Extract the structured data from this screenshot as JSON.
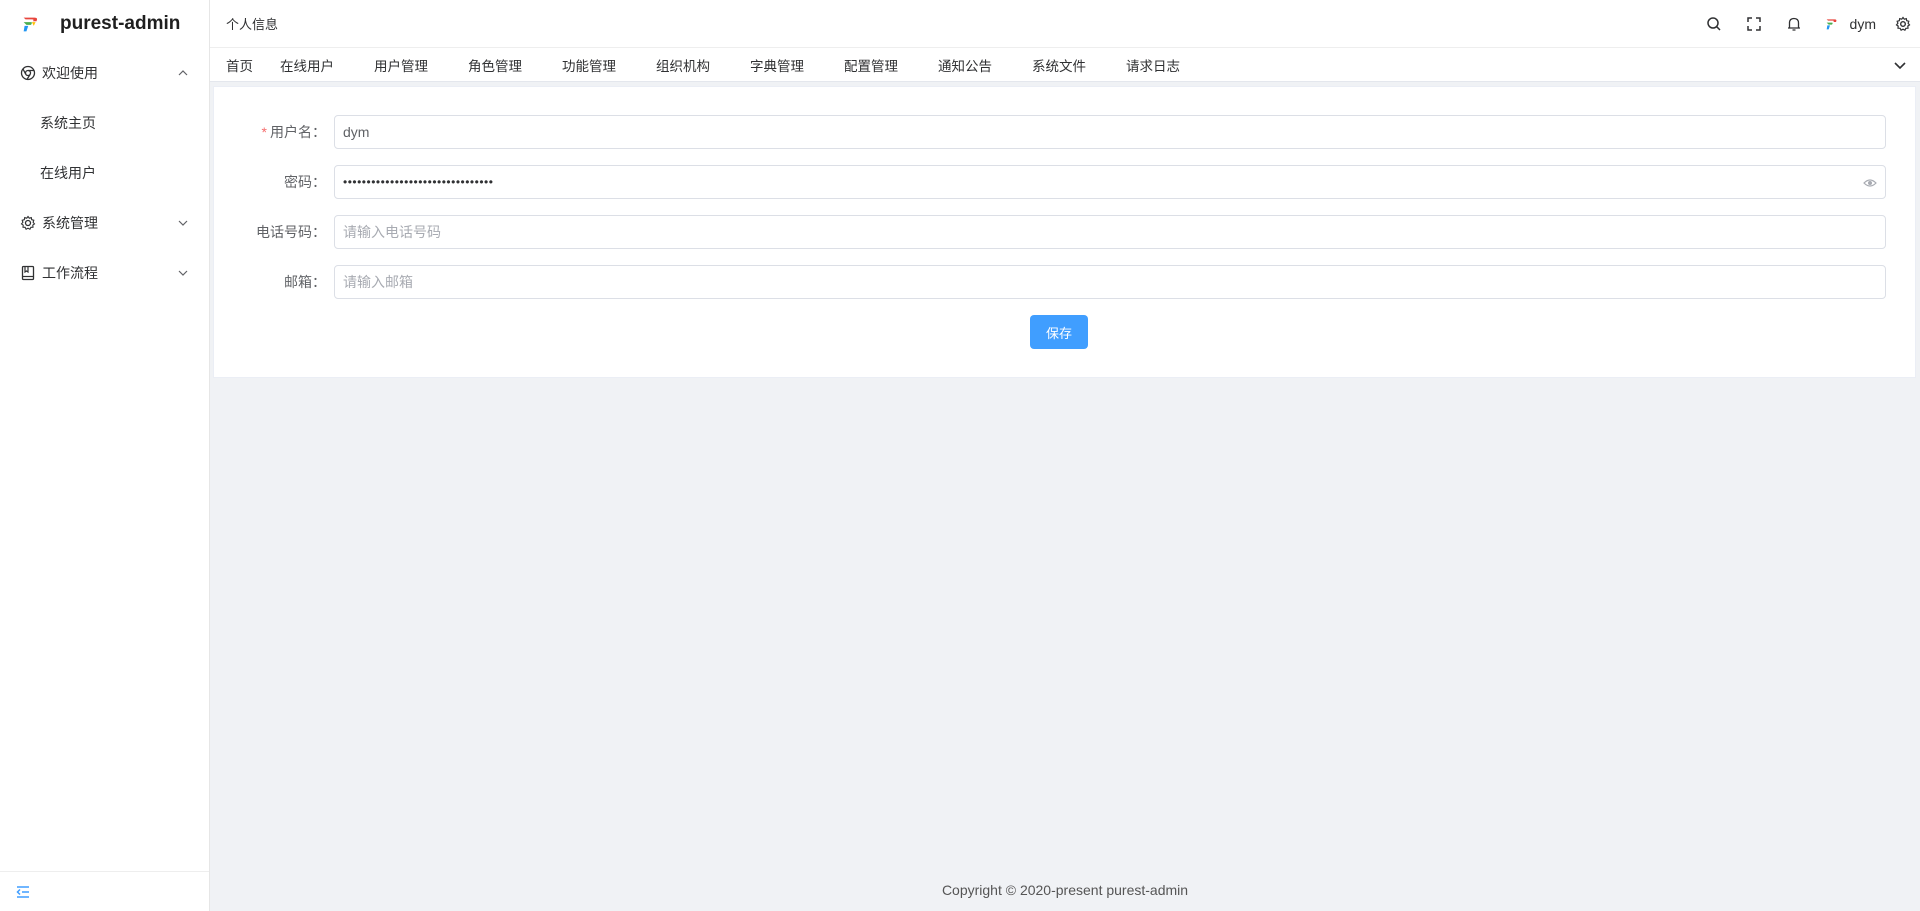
{
  "app": {
    "title": "purest-admin"
  },
  "sidebar": {
    "groups": [
      {
        "label": "欢迎使用",
        "icon": "chrome-icon",
        "expanded": true,
        "children": [
          {
            "label": "系统主页"
          },
          {
            "label": "在线用户"
          }
        ]
      },
      {
        "label": "系统管理",
        "icon": "gear-icon",
        "expanded": false
      },
      {
        "label": "工作流程",
        "icon": "book-icon",
        "expanded": false
      }
    ]
  },
  "header": {
    "breadcrumb": "个人信息",
    "username": "dym"
  },
  "tabs": [
    "首页",
    "在线用户",
    "用户管理",
    "角色管理",
    "功能管理",
    "组织机构",
    "字典管理",
    "配置管理",
    "通知公告",
    "系统文件",
    "请求日志"
  ],
  "form": {
    "username_label": "用户名",
    "username_value": "dym",
    "password_label": "密码",
    "password_mask": "••••••••••••••••••••••••••••••••",
    "phone_label": "电话号码",
    "phone_placeholder": "请输入电话号码",
    "email_label": "邮箱",
    "email_placeholder": "请输入邮箱",
    "colon": "：",
    "save_label": "保存"
  },
  "footer": {
    "copyright": "Copyright © 2020-present purest-admin"
  },
  "colors": {
    "primary": "#409eff",
    "required": "#f56c6c",
    "background": "#f0f2f5"
  }
}
